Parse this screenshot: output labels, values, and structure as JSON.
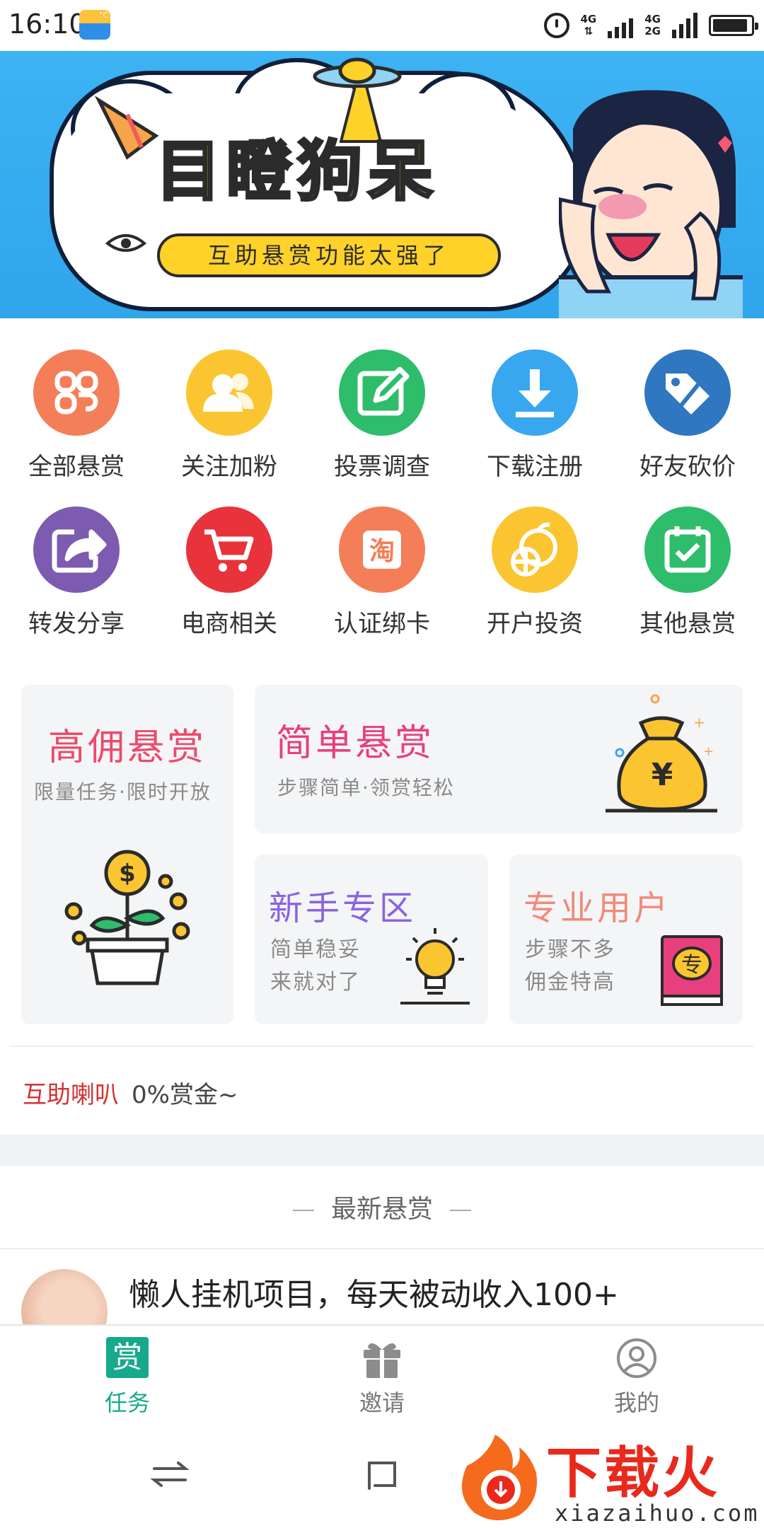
{
  "status_bar": {
    "time": "16:10",
    "net_top": "4G",
    "net_mid": "4G",
    "net_bottom": "2G"
  },
  "banner": {
    "title": "目瞪狗呆",
    "subtitle": "互助悬赏功能太强了",
    "slide_count": 2,
    "active_slide": 2
  },
  "categories": [
    {
      "label": "全部悬赏",
      "icon": "clover-icon",
      "color": "#f47e57"
    },
    {
      "label": "关注加粉",
      "icon": "users-icon",
      "color": "#fbc531"
    },
    {
      "label": "投票调查",
      "icon": "edit-icon",
      "color": "#2ebd6b"
    },
    {
      "label": "下载注册",
      "icon": "download-icon",
      "color": "#39a6f0"
    },
    {
      "label": "好友砍价",
      "icon": "tag-icon",
      "color": "#2f77c0"
    },
    {
      "label": "转发分享",
      "icon": "share-icon",
      "color": "#7c5bb0"
    },
    {
      "label": "电商相关",
      "icon": "cart-icon",
      "color": "#e8333a"
    },
    {
      "label": "认证绑卡",
      "icon": "taobao-icon",
      "color": "#f47e57"
    },
    {
      "label": "开户投资",
      "icon": "orange-icon",
      "color": "#fbc531"
    },
    {
      "label": "其他悬赏",
      "icon": "calendar-check-icon",
      "color": "#2ebd6b"
    }
  ],
  "cards": {
    "high": {
      "title": "高佣悬赏",
      "subtitle": "限量任务·限时开放",
      "color": "#ec4a6a"
    },
    "simple": {
      "title": "简单悬赏",
      "subtitle": "步骤简单·领赏轻松",
      "color": "#e8407e",
      "icon_text": "¥"
    },
    "newbie": {
      "title": "新手专区",
      "line1": "简单稳妥",
      "line2": "来就对了",
      "color": "#8a63e0"
    },
    "pro": {
      "title": "专业用户",
      "line1": "步骤不多",
      "line2": "佣金特高",
      "color": "#f08a7a",
      "icon_text": "专"
    }
  },
  "announcement": {
    "label": "互助喇叭",
    "text": "0%赏金~"
  },
  "latest": {
    "section_title": "最新悬赏",
    "task_title": "懒人挂机项目，每天被动收入100+"
  },
  "tabbar": {
    "tabs": [
      {
        "label": "任务",
        "icon_text": "赏"
      },
      {
        "label": "邀请"
      },
      {
        "label": "我的"
      }
    ]
  },
  "watermark": {
    "brand": "下载火",
    "url": "xiazaihuo.com"
  }
}
